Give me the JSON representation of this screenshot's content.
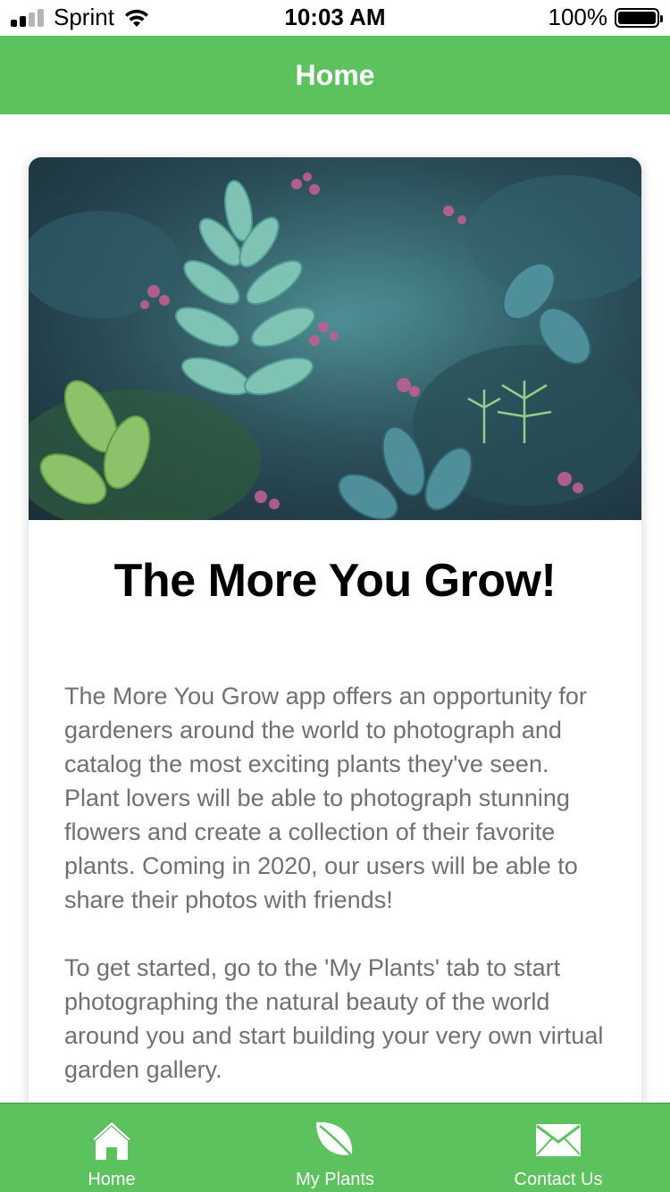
{
  "colors": {
    "accent": "#5cc25e",
    "title_text": "#000000",
    "body_text": "#707070"
  },
  "status_bar": {
    "carrier": "Sprint",
    "time": "10:03 AM",
    "battery": "100%"
  },
  "header": {
    "title": "Home"
  },
  "card": {
    "image_alt_icon": "plants-photo",
    "title": "The More You Grow!",
    "paragraphs": [
      "The More You Grow app offers an opportunity for gardeners around the world to photograph and catalog the most exciting plants they've seen. Plant lovers will be able to photograph stunning flowers and create a collection of their favorite plants. Coming in 2020, our users will be able to share their photos with friends!",
      "To get started, go to the 'My Plants' tab to start photographing the natural beauty of the world around you and start building your very own virtual garden gallery."
    ]
  },
  "tab_bar": {
    "tabs": [
      {
        "label": "Home",
        "icon": "home-icon"
      },
      {
        "label": "My Plants",
        "icon": "leaf-icon"
      },
      {
        "label": "Contact Us",
        "icon": "envelope-icon"
      }
    ]
  }
}
